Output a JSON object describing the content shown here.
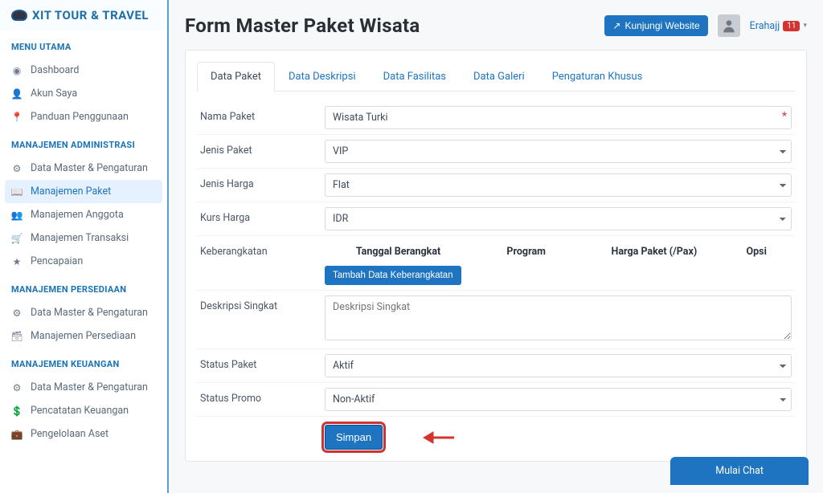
{
  "brand": "XIT TOUR & TRAVEL",
  "sidebar": {
    "sections": [
      {
        "title": "MENU UTAMA",
        "items": [
          {
            "icon": "◉",
            "label": "Dashboard"
          },
          {
            "icon": "👤",
            "label": "Akun Saya"
          },
          {
            "icon": "📍",
            "label": "Panduan Penggunaan"
          }
        ]
      },
      {
        "title": "MANAJEMEN ADMINISTRASI",
        "items": [
          {
            "icon": "⚙",
            "label": "Data Master & Pengaturan"
          },
          {
            "icon": "📖",
            "label": "Manajemen Paket",
            "active": true
          },
          {
            "icon": "👥",
            "label": "Manajemen Anggota"
          },
          {
            "icon": "🛒",
            "label": "Manajemen Transaksi"
          },
          {
            "icon": "★",
            "label": "Pencapaian"
          }
        ]
      },
      {
        "title": "MANAJEMEN PERSEDIAAN",
        "items": [
          {
            "icon": "⚙",
            "label": "Data Master & Pengaturan"
          },
          {
            "icon": "🗃",
            "label": "Manajemen Persediaan"
          }
        ]
      },
      {
        "title": "MANAJEMEN KEUANGAN",
        "items": [
          {
            "icon": "⚙",
            "label": "Data Master & Pengaturan"
          },
          {
            "icon": "💲",
            "label": "Pencatatan Keuangan"
          },
          {
            "icon": "💼",
            "label": "Pengelolaan Aset"
          }
        ]
      }
    ]
  },
  "header": {
    "title": "Form Master Paket Wisata",
    "visit_label": "Kunjungi Website",
    "user_name": "Erahajj",
    "badge": "11"
  },
  "tabs": [
    "Data Paket",
    "Data Deskripsi",
    "Data Fasilitas",
    "Data Galeri",
    "Pengaturan Khusus"
  ],
  "form": {
    "nama_paket_label": "Nama Paket",
    "nama_paket_value": "Wisata Turki",
    "jenis_paket_label": "Jenis Paket",
    "jenis_paket_value": "VIP",
    "jenis_harga_label": "Jenis Harga",
    "jenis_harga_value": "Flat",
    "kurs_label": "Kurs Harga",
    "kurs_value": "IDR",
    "keberangkatan_label": "Keberangkatan",
    "dep_cols": {
      "c1": "Tanggal Berangkat",
      "c2": "Program",
      "c3": "Harga Paket (/Pax)",
      "c4": "Opsi"
    },
    "tambah_btn": "Tambah Data Keberangkatan",
    "desk_label": "Deskripsi Singkat",
    "desk_placeholder": "Deskripsi Singkat",
    "status_paket_label": "Status Paket",
    "status_paket_value": "Aktif",
    "status_promo_label": "Status Promo",
    "status_promo_value": "Non-Aktif",
    "save_label": "Simpan"
  },
  "chat": {
    "label": "Mulai Chat"
  }
}
